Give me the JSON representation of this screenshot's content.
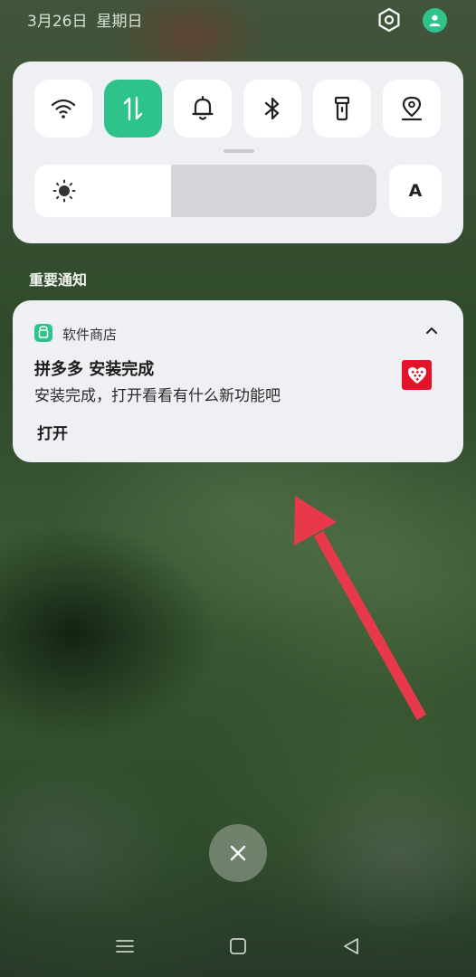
{
  "status": {
    "date": "3月26日",
    "weekday": "星期日"
  },
  "quick_settings": {
    "tiles": [
      {
        "name": "wifi-icon",
        "active": false
      },
      {
        "name": "mobile-data-icon",
        "active": true
      },
      {
        "name": "bell-icon",
        "active": false
      },
      {
        "name": "bluetooth-icon",
        "active": false
      },
      {
        "name": "flashlight-icon",
        "active": false
      },
      {
        "name": "location-icon",
        "active": false
      }
    ],
    "brightness_level": 0.4,
    "auto_label": "A"
  },
  "notifications": {
    "section_title": "重要通知",
    "app_name": "软件商店",
    "title": "拼多多 安装完成",
    "body": "安装完成，打开看看有什么新功能吧",
    "action": "打开"
  },
  "colors": {
    "accent": "#2fc38c",
    "annotation_arrow": "#e8394b",
    "thumb_red": "#e5122c"
  }
}
